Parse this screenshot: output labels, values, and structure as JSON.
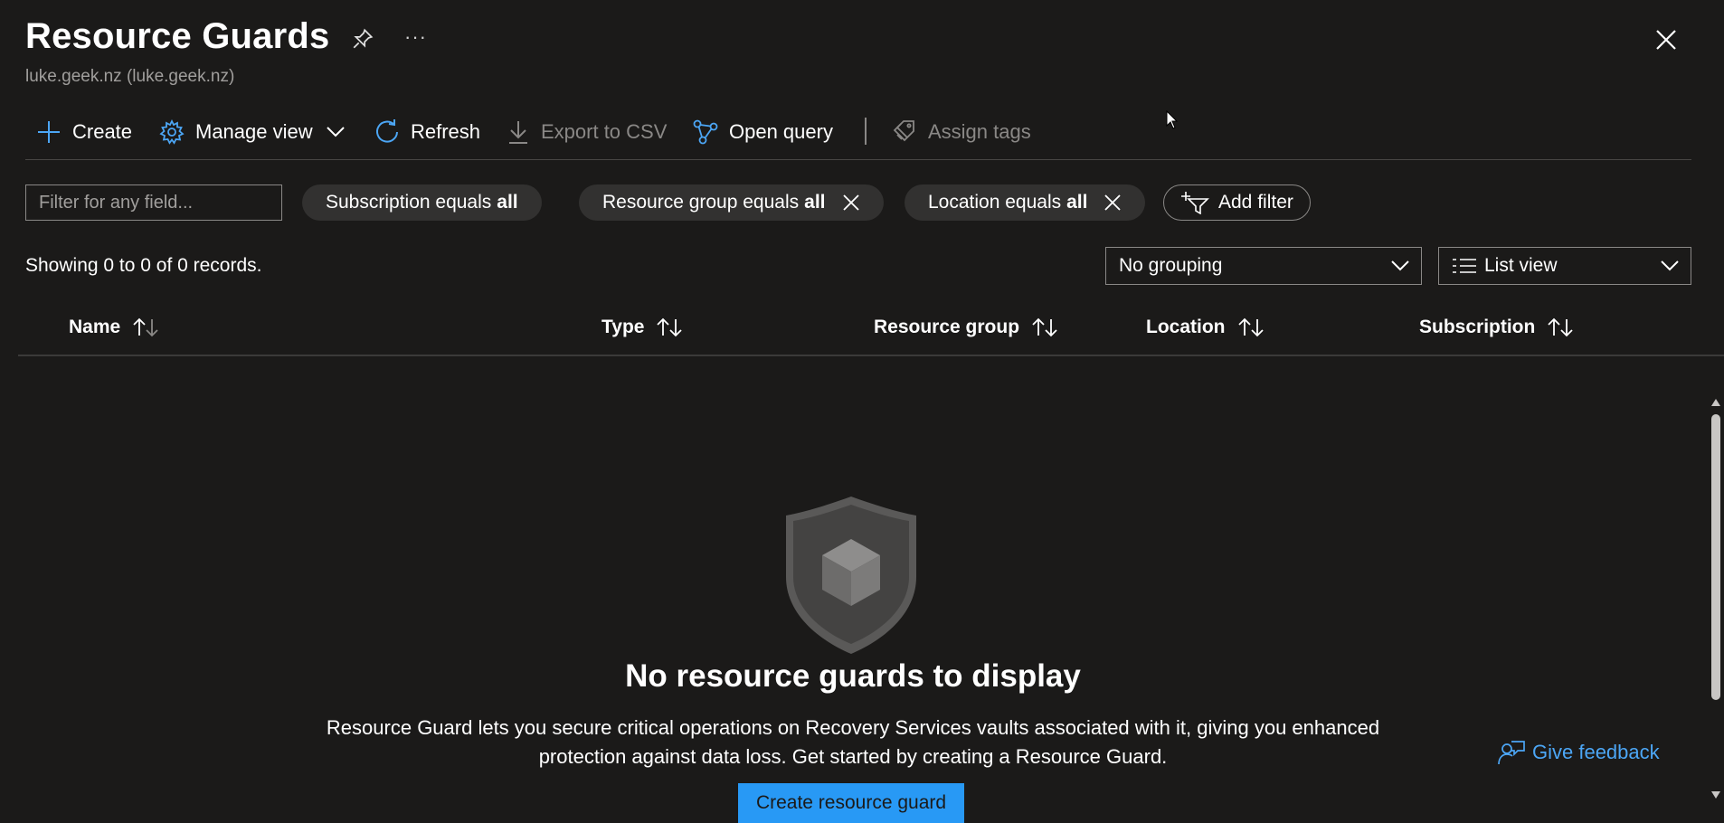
{
  "header": {
    "title": "Resource Guards",
    "subtitle": "luke.geek.nz (luke.geek.nz)",
    "more_label": "···"
  },
  "toolbar": {
    "create": "Create",
    "manage_view": "Manage view",
    "refresh": "Refresh",
    "export_csv": "Export to CSV",
    "open_query": "Open query",
    "assign_tags": "Assign tags"
  },
  "filters": {
    "search_placeholder": "Filter for any field...",
    "pills": [
      {
        "text": "Subscription equals",
        "value": "all"
      },
      {
        "text": "Resource group equals",
        "value": "all"
      },
      {
        "text": "Location equals",
        "value": "all"
      }
    ],
    "add_filter": "Add filter"
  },
  "records": {
    "summary": "Showing 0 to 0 of 0 records."
  },
  "view_controls": {
    "grouping": "No grouping",
    "view_mode": "List view"
  },
  "table": {
    "columns": [
      "Name",
      "Type",
      "Resource group",
      "Location",
      "Subscription"
    ]
  },
  "empty_state": {
    "title": "No resource guards to display",
    "description_line1": "Resource Guard lets you secure critical operations on Recovery Services vaults associated with it, giving you enhanced",
    "description_line2": "protection against data loss. Get started by creating a Resource Guard.",
    "button": "Create resource guard",
    "feedback": "Give feedback"
  },
  "colors": {
    "background": "#1b1a19",
    "accent": "#4ca6f5",
    "primary_button": "#2899f5",
    "pill": "#323130"
  }
}
